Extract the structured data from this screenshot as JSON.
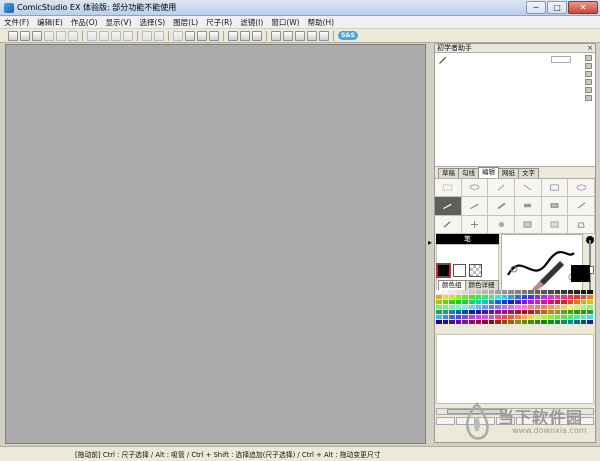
{
  "window": {
    "title": "ComicStudio EX 体验版: 部分功能不能使用",
    "minimize": "─",
    "maximize": "□",
    "close": "✕"
  },
  "menu": [
    "文件(F)",
    "编辑(E)",
    "作品(O)",
    "显示(V)",
    "选择(S)",
    "图层(L)",
    "尺子(R)",
    "滤镜(I)",
    "窗口(W)",
    "帮助(H)"
  ],
  "toolbar": {
    "badge_text": "S&S"
  },
  "panel": {
    "title": "初学者助手",
    "close_label": "×",
    "tabs": [
      "草稿",
      "勾线",
      "编辑",
      "网纸",
      "文字"
    ],
    "active_tab": "编辑",
    "pen_label": "笔",
    "color_tabs": [
      "颜色组",
      "颜色详细"
    ],
    "active_color_tab": "颜色组"
  },
  "canvas": {
    "collapse_arrow": "▸"
  },
  "status": {
    "text": "[拖动前] Ctrl : 尺子选择 / Alt : 吸管 / Ctrl + Shift : 选择追加(尺子选择) / Ctrl + Alt : 拖动变更尺寸"
  },
  "watermark": {
    "title": "当下软件园",
    "url": "www.downxia.com"
  },
  "colors": {
    "canvas_bg": "#ababab",
    "selected_color": "#000000"
  }
}
